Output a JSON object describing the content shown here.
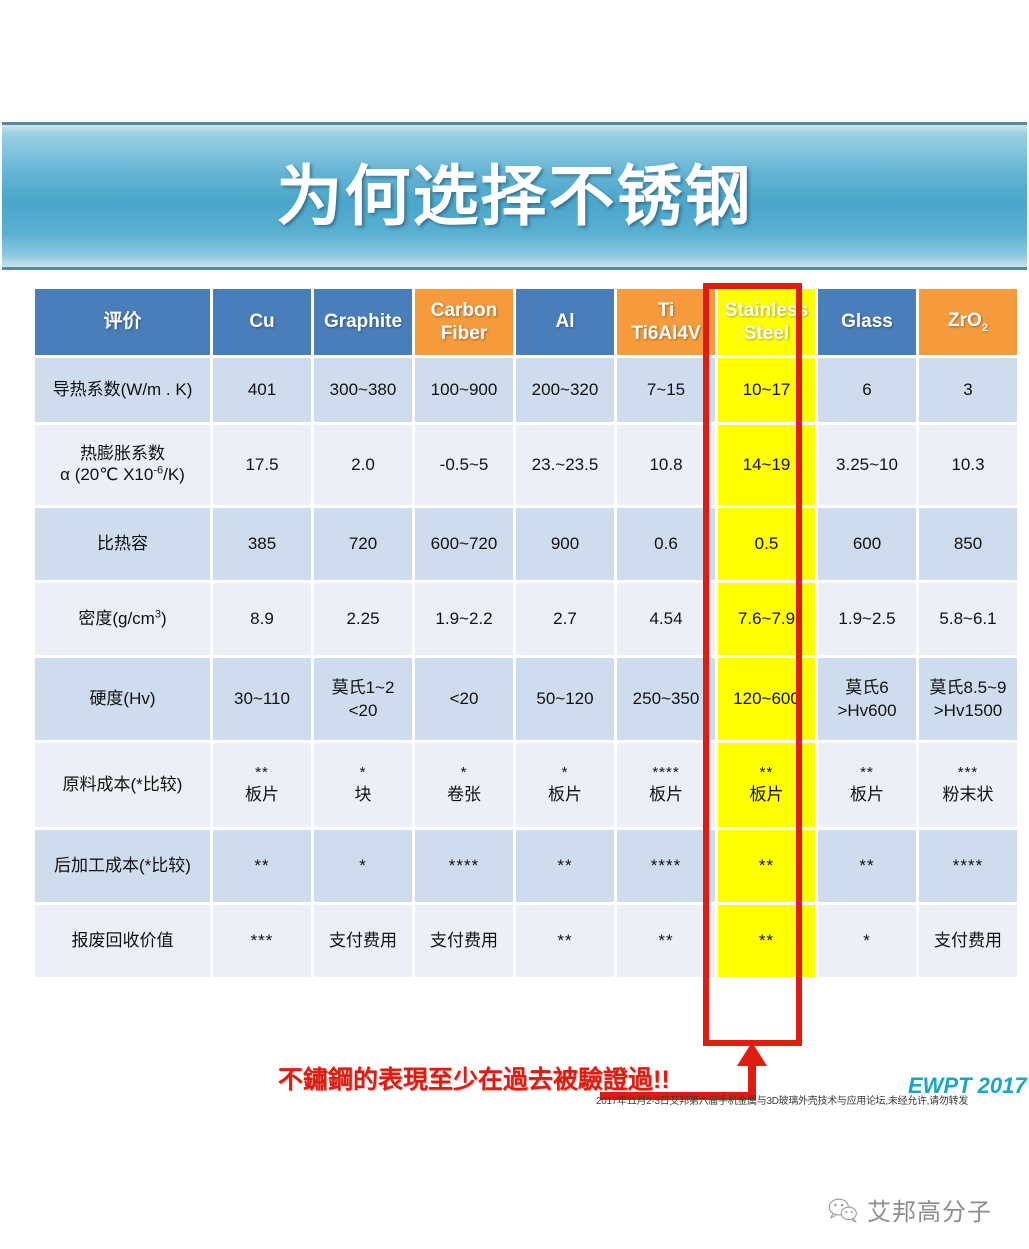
{
  "slide": {
    "title": "为何选择不锈钢"
  },
  "table": {
    "columns": [
      {
        "label": "评价",
        "style": "blue"
      },
      {
        "label": "Cu",
        "style": "blue"
      },
      {
        "label": "Graphite",
        "style": "blue"
      },
      {
        "label": "Carbon Fiber",
        "style": "orange"
      },
      {
        "label": "Al",
        "style": "blue"
      },
      {
        "label": "Ti Ti6Al4V",
        "style": "orange"
      },
      {
        "label": "Stainless Steel",
        "style": "yellow"
      },
      {
        "label": "Glass",
        "style": "blue"
      },
      {
        "label": "ZrO2",
        "style": "orange"
      }
    ],
    "rows": [
      {
        "label": "导热系数(W/m . K)",
        "cells": [
          "401",
          "300~380",
          "100~900",
          "200~320",
          "7~15",
          "10~17",
          "6",
          "3"
        ]
      },
      {
        "label": "热膨胀系数 α (20℃ X10-6/K)",
        "cells": [
          "17.5",
          "2.0",
          "-0.5~5",
          "23.~23.5",
          "10.8",
          "14~19",
          "3.25~10",
          "10.3"
        ]
      },
      {
        "label": "比热容",
        "cells": [
          "385",
          "720",
          "600~720",
          "900",
          "0.6",
          "0.5",
          "600",
          "850"
        ]
      },
      {
        "label": "密度(g/cm3)",
        "cells": [
          "8.9",
          "2.25",
          "1.9~2.2",
          "2.7",
          "4.54",
          "7.6~7.9",
          "1.9~2.5",
          "5.8~6.1"
        ]
      },
      {
        "label": "硬度(Hv)",
        "cells": [
          "30~110",
          "莫氏1~2\n<20",
          "<20",
          "50~120",
          "250~350",
          "120~600",
          "莫氏6\n>Hv600",
          "莫氏8.5~9\n>Hv1500"
        ]
      },
      {
        "label": "原料成本(*比较)",
        "cells": [
          "**\n板片",
          "*\n块",
          "*\n卷张",
          "*\n板片",
          "****\n板片",
          "**\n板片",
          "**\n板片",
          "***\n粉末状"
        ]
      },
      {
        "label": "后加工成本(*比较)",
        "cells": [
          "**",
          "*",
          "****",
          "**",
          "****",
          "**",
          "**",
          "****"
        ]
      },
      {
        "label": "报废回收价值",
        "cells": [
          "***",
          "支付费用",
          "支付费用",
          "**",
          "**",
          "**",
          "*",
          "支付费用"
        ]
      }
    ],
    "highlight_column_index": 6,
    "highlight_color": "#ffff00",
    "highlight_border_color": "#e01b10"
  },
  "annotation": {
    "text": "不鏽鋼的表現至少在過去被驗證過!!",
    "color": "#e01b10"
  },
  "footnote": {
    "text": "2017年11月2-3日艾邦第六届手机金属与3D玻璃外壳技术与应用论坛,未经允许,请勿转发"
  },
  "watermark": {
    "text": "EWPT 2017",
    "color": "#16a6c7"
  },
  "brand": {
    "name": "艾邦高分子",
    "icon": "wechat-icon"
  },
  "theme": {
    "header_blue": "#4a7ebb",
    "header_orange": "#f59b3c",
    "band_a": "#cfdcee",
    "band_b": "#eceff6",
    "banner_blue": "#4aa6cb"
  }
}
